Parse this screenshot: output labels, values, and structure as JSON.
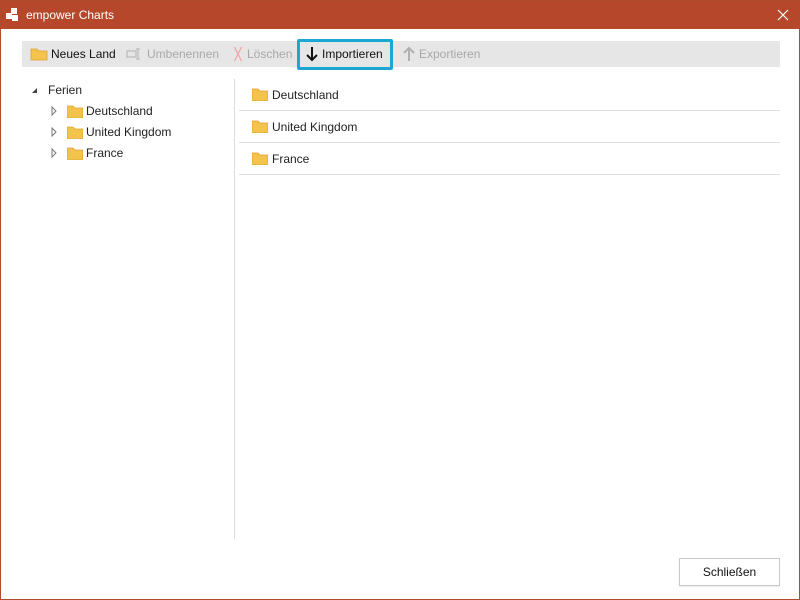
{
  "window": {
    "title": "empower Charts",
    "title_bar_color": "#b7472a"
  },
  "toolbar": {
    "buttons": [
      {
        "label": "Neues Land",
        "icon": "folder-icon",
        "enabled": true
      },
      {
        "label": "Umbenennen",
        "icon": "rename-icon",
        "enabled": false
      },
      {
        "label": "Löschen",
        "icon": "delete-x-icon",
        "enabled": false
      },
      {
        "label": "Importieren",
        "icon": "arrow-down-icon",
        "enabled": true,
        "highlighted": true
      },
      {
        "label": "Exportieren",
        "icon": "arrow-up-icon",
        "enabled": false
      }
    ],
    "highlight_color": "#1aa7d4"
  },
  "tree": {
    "root": {
      "label": "Ferien",
      "expanded": true
    },
    "children": [
      {
        "label": "Deutschland",
        "expanded": false
      },
      {
        "label": "United Kingdom",
        "expanded": false
      },
      {
        "label": "France",
        "expanded": false
      }
    ]
  },
  "list": {
    "items": [
      "Deutschland",
      "United Kingdom",
      "France"
    ]
  },
  "footer": {
    "close_label": "Schließen"
  },
  "colors": {
    "folder": "#f3c34b",
    "folder_dark": "#dca431"
  }
}
